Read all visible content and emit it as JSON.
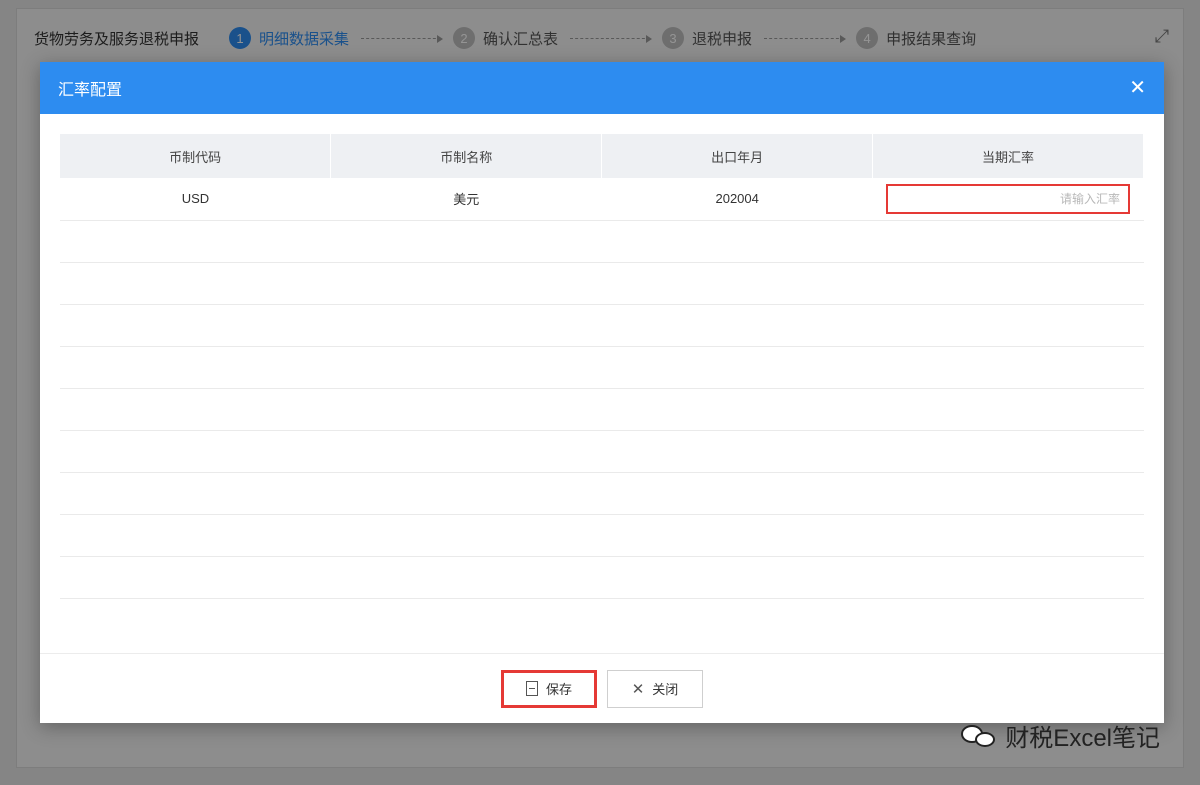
{
  "background_page": {
    "app_title": "货物劳务及服务退税申报",
    "steps": [
      {
        "num": "1",
        "label": "明细数据采集",
        "active": true
      },
      {
        "num": "2",
        "label": "确认汇总表",
        "active": false
      },
      {
        "num": "3",
        "label": "退税申报",
        "active": false
      },
      {
        "num": "4",
        "label": "申报结果查询",
        "active": false
      }
    ],
    "fullscreen_icon": "expand-icon"
  },
  "modal": {
    "title": "汇率配置",
    "close_icon": "close-icon",
    "columns": [
      "币制代码",
      "币制名称",
      "出口年月",
      "当期汇率"
    ],
    "rows": [
      {
        "code": "USD",
        "name": "美元",
        "period": "202004",
        "rate_value": "",
        "rate_placeholder": "请输入汇率"
      }
    ],
    "footer": {
      "save_label": "保存",
      "close_label": "关闭"
    }
  },
  "watermark": {
    "text": "财税Excel笔记",
    "icon": "wechat-icon"
  },
  "colors": {
    "primary": "#2d8cf0",
    "highlight": "#e53935"
  }
}
